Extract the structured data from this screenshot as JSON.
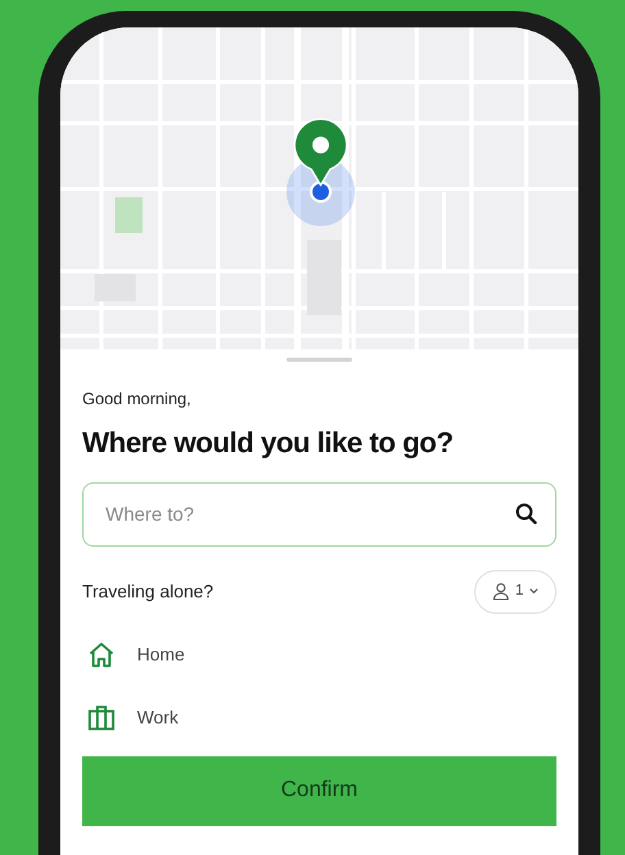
{
  "greeting": "Good morning,",
  "heading": "Where would you like to go?",
  "search": {
    "placeholder": "Where to?"
  },
  "travel": {
    "label": "Traveling alone?",
    "passengers": "1"
  },
  "places": [
    {
      "kind": "home",
      "label": "Home"
    },
    {
      "kind": "work",
      "label": "Work"
    }
  ],
  "confirm_button": "Confirm"
}
